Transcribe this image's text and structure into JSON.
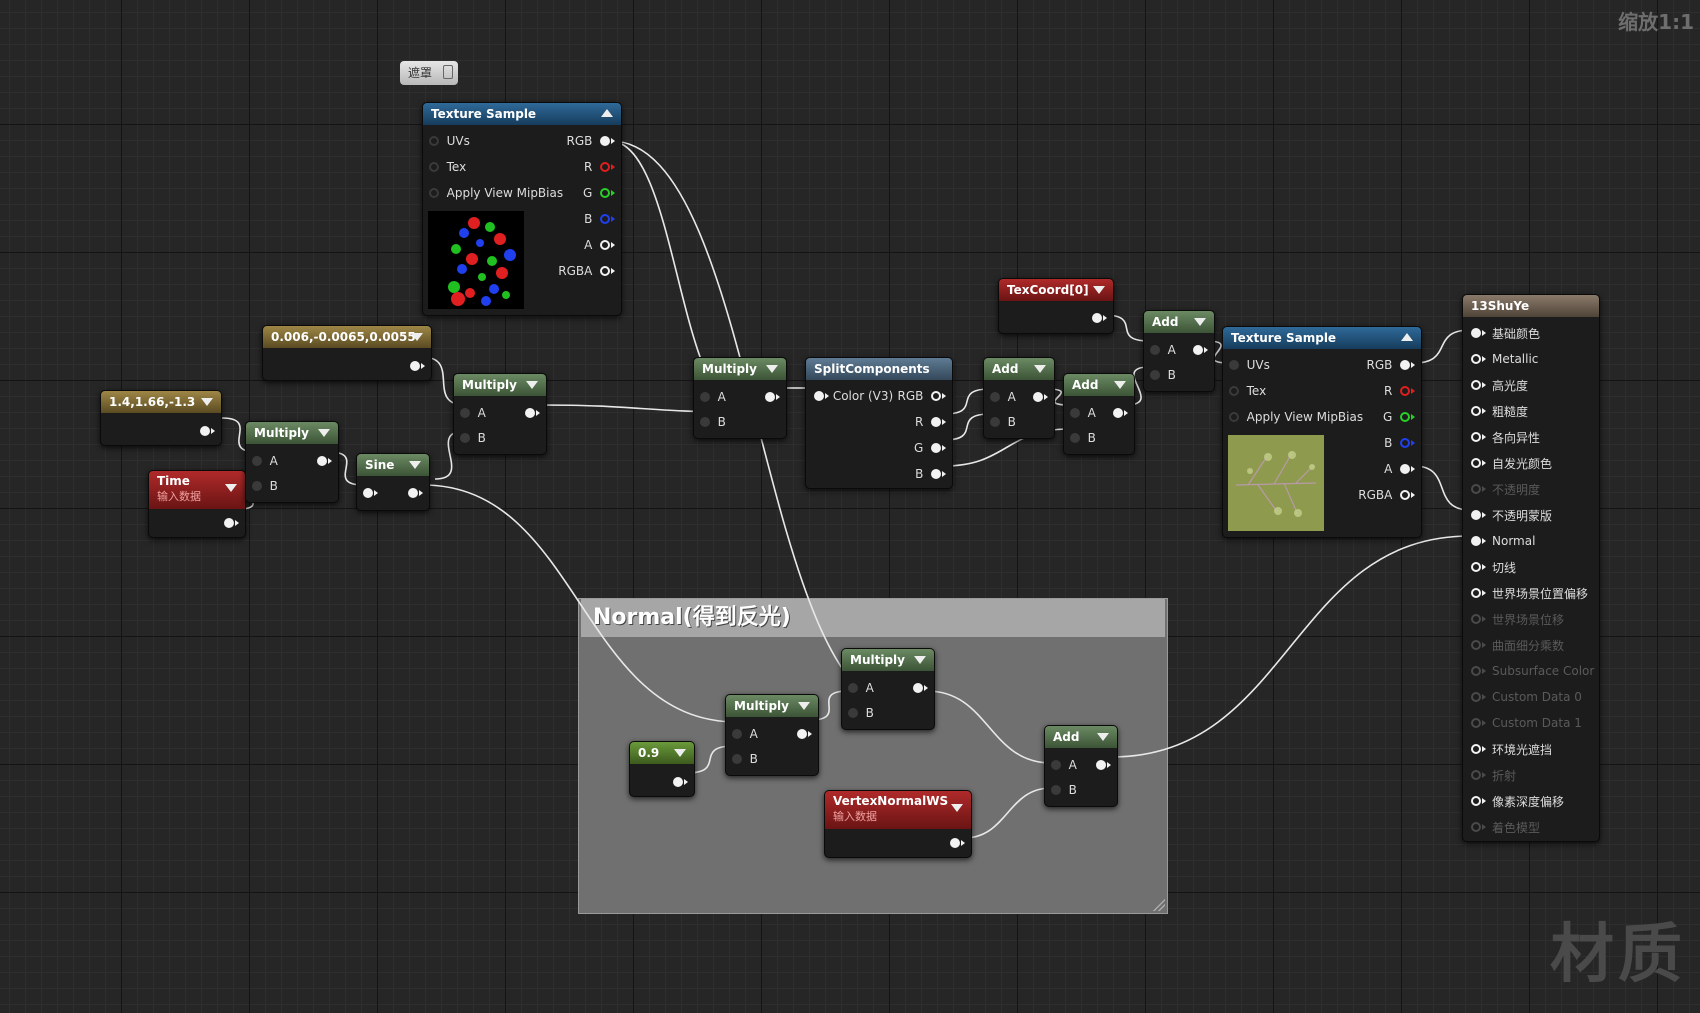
{
  "canvas": {
    "zoom_label": "缩放1:1",
    "watermark": "材质"
  },
  "comment": {
    "title": "Normal(得到反光)"
  },
  "mask_tag": "遮罩",
  "nodes": {
    "tex1": {
      "title": "Texture Sample",
      "inputs": [
        "UVs",
        "Tex",
        "Apply View MipBias"
      ],
      "outputs": [
        "RGB",
        "R",
        "G",
        "B",
        "A",
        "RGBA"
      ]
    },
    "tex2": {
      "title": "Texture Sample",
      "inputs": [
        "UVs",
        "Tex",
        "Apply View MipBias"
      ],
      "outputs": [
        "RGB",
        "R",
        "G",
        "B",
        "A",
        "RGBA"
      ]
    },
    "const_a": {
      "title": "0.006,-0.0065,0.0055"
    },
    "const_b": {
      "title": "1.4,1.66,-1.3"
    },
    "time": {
      "title": "Time",
      "subtitle": "输入数据"
    },
    "multiply_1": {
      "title": "Multiply",
      "a": "A",
      "b": "B"
    },
    "multiply_2": {
      "title": "Multiply",
      "a": "A",
      "b": "B"
    },
    "multiply_3": {
      "title": "Multiply",
      "a": "A",
      "b": "B"
    },
    "multiply_4": {
      "title": "Multiply",
      "a": "A",
      "b": "B"
    },
    "multiply_5": {
      "title": "Multiply",
      "a": "A",
      "b": "B"
    },
    "sine": {
      "title": "Sine"
    },
    "split": {
      "title": "SplitComponents",
      "input": "Color (V3)",
      "outputs": [
        "RGB",
        "R",
        "G",
        "B"
      ]
    },
    "add_1": {
      "title": "Add",
      "a": "A",
      "b": "B"
    },
    "add_2": {
      "title": "Add",
      "a": "A",
      "b": "B"
    },
    "add_3": {
      "title": "Add",
      "a": "A",
      "b": "B"
    },
    "add_4": {
      "title": "Add",
      "a": "A",
      "b": "B"
    },
    "texcoord": {
      "title": "TexCoord[0]"
    },
    "const_09": {
      "title": "0.9"
    },
    "vertex_normal": {
      "title": "VertexNormalWS",
      "subtitle": "输入数据"
    },
    "result": {
      "title": "13ShuYe",
      "pins": [
        {
          "label": "基础颜色",
          "enabled": true,
          "connected": true
        },
        {
          "label": "Metallic",
          "enabled": true,
          "connected": false
        },
        {
          "label": "高光度",
          "enabled": true,
          "connected": false
        },
        {
          "label": "粗糙度",
          "enabled": true,
          "connected": false
        },
        {
          "label": "各向异性",
          "enabled": true,
          "connected": false
        },
        {
          "label": "自发光颜色",
          "enabled": true,
          "connected": false
        },
        {
          "label": "不透明度",
          "enabled": false,
          "connected": false
        },
        {
          "label": "不透明蒙版",
          "enabled": true,
          "connected": true
        },
        {
          "label": "Normal",
          "enabled": true,
          "connected": true
        },
        {
          "label": "切线",
          "enabled": true,
          "connected": false
        },
        {
          "label": "世界场景位置偏移",
          "enabled": true,
          "connected": false
        },
        {
          "label": "世界场景位移",
          "enabled": false,
          "connected": false
        },
        {
          "label": "曲面细分乘数",
          "enabled": false,
          "connected": false
        },
        {
          "label": "Subsurface Color",
          "enabled": false,
          "connected": false
        },
        {
          "label": "Custom Data 0",
          "enabled": false,
          "connected": false
        },
        {
          "label": "Custom Data 1",
          "enabled": false,
          "connected": false
        },
        {
          "label": "环境光遮挡",
          "enabled": true,
          "connected": false
        },
        {
          "label": "折射",
          "enabled": false,
          "connected": false
        },
        {
          "label": "像素深度偏移",
          "enabled": true,
          "connected": false
        },
        {
          "label": "着色模型",
          "enabled": false,
          "connected": false
        }
      ]
    }
  },
  "colors": {
    "wire": "#e8e8e8",
    "pin_red": "#e01e1e",
    "pin_green": "#28d028",
    "pin_blue": "#2040f0"
  }
}
